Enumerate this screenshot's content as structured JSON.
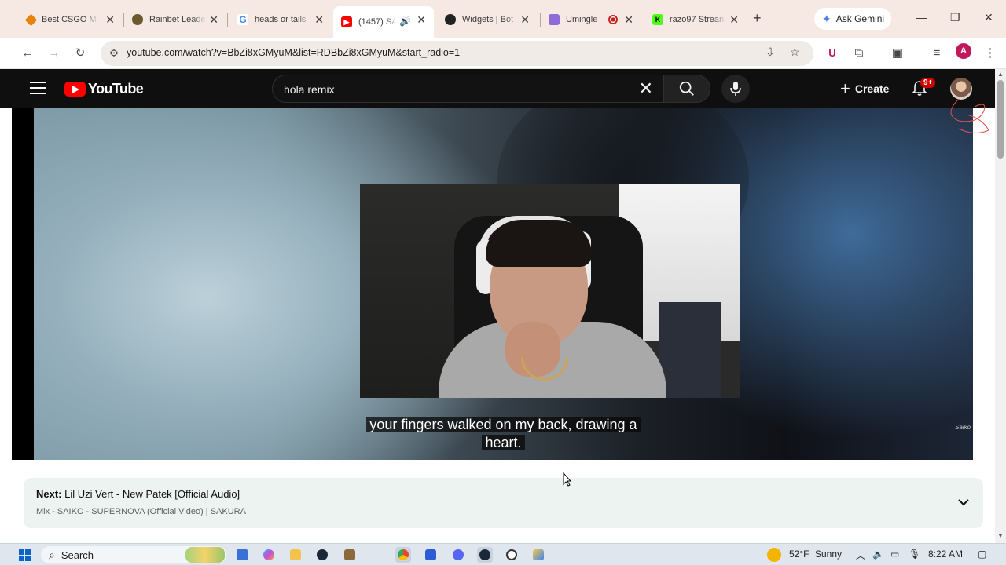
{
  "browser": {
    "tabs": [
      {
        "title": "Best CSGO M",
        "favicon": "#e8820c",
        "active": false
      },
      {
        "title": "Rainbet Leade",
        "favicon": "#6b5a2e",
        "active": false
      },
      {
        "title": "heads or tails",
        "favicon": "#4285f4",
        "active": false
      },
      {
        "title": "(1457) SA",
        "favicon": "#ff0000",
        "active": true
      },
      {
        "title": "Widgets | Bot",
        "favicon": "#222222",
        "active": false
      },
      {
        "title": "Umingle",
        "favicon": "#8e6bd8",
        "active": false
      },
      {
        "title": "razo97 Strean",
        "favicon": "#53fc18",
        "active": false
      }
    ],
    "new_tab_icon": "plus-icon",
    "gemini_label": "Ask Gemini",
    "url": "youtube.com/watch?v=BbZi8xGMyuM&list=RDBbZi8xGMyuM&start_radio=1",
    "profile_initial": "A"
  },
  "youtube": {
    "logo_text": "YouTube",
    "search_query": "hola remix",
    "create_label": "Create",
    "notification_badge": "9+",
    "caption_text": "your fingers walked on my back, drawing a heart.",
    "watermark": "Saiko",
    "next": {
      "label": "Next:",
      "title": "Lil Uzi Vert - New Patek [Official Audio]",
      "subtitle": "Mix - SAIKO - SUPERNOVA (Official Video) | SAKURA"
    }
  },
  "taskbar": {
    "search_label": "Search",
    "weather_temp": "52°F",
    "weather_desc": "Sunny",
    "time": "8:22 AM"
  }
}
